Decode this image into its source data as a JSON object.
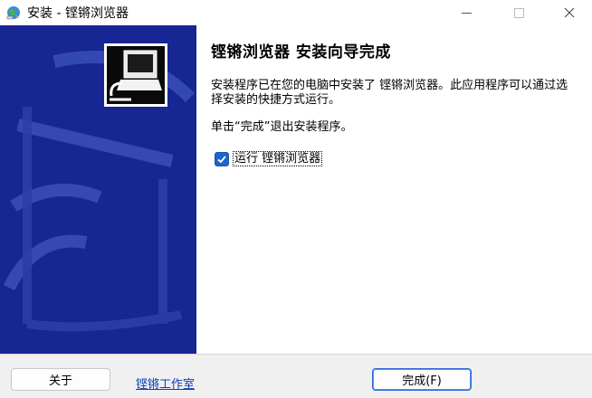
{
  "window": {
    "title": "安装 - 铿锵浏览器",
    "icon": "installer-globe-icon"
  },
  "main": {
    "heading": "铿锵浏览器 安装向导完成",
    "paragraph1": "安装程序已在您的电脑中安装了 铿锵浏览器。此应用程序可以通过选择安装的快捷方式运行。",
    "paragraph2": "单击“完成”退出安装程序。",
    "run_option": {
      "label": "运行 铿锵浏览器",
      "checked": true
    }
  },
  "footer": {
    "about_label": "关于",
    "link_label": "铿锵工作室",
    "finish_label": "完成(F)"
  },
  "colors": {
    "side_panel": "#0d1a7a",
    "checkbox": "#1f64c8",
    "link": "#0b3fb3",
    "default_button_border": "#2a6ad8"
  }
}
